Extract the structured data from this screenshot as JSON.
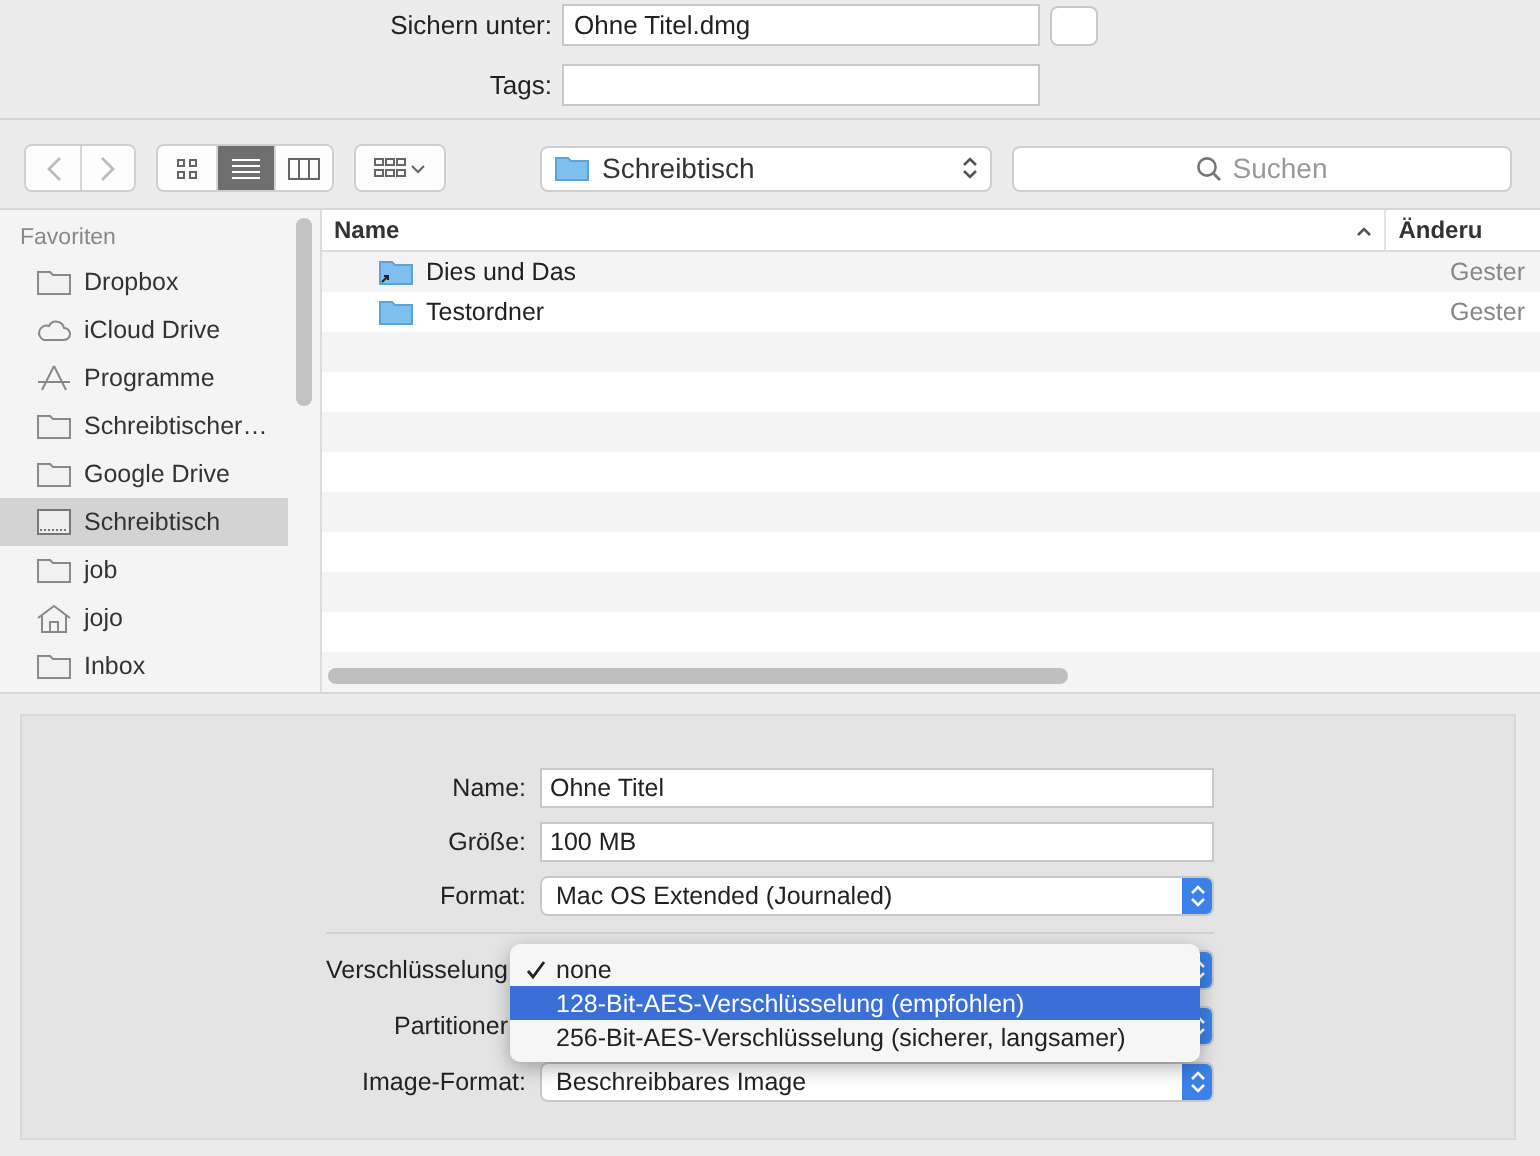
{
  "save_as": {
    "label": "Sichern unter:",
    "value": "Ohne Titel.dmg"
  },
  "tags": {
    "label": "Tags:"
  },
  "toolbar": {
    "view_modes": [
      {
        "kind": "icons",
        "selected": false
      },
      {
        "kind": "list",
        "selected": true
      },
      {
        "kind": "columns",
        "selected": false
      }
    ],
    "location": "Schreibtisch",
    "search": {
      "placeholder": "Suchen"
    }
  },
  "sidebar": {
    "heading": "Favoriten",
    "items": [
      {
        "label": "Dropbox",
        "kind": "folder",
        "selected": false
      },
      {
        "label": "iCloud Drive",
        "kind": "cloud",
        "selected": false
      },
      {
        "label": "Programme",
        "kind": "apps",
        "selected": false
      },
      {
        "label": "Schreibtischer…",
        "kind": "folder",
        "selected": false
      },
      {
        "label": "Google Drive",
        "kind": "folder",
        "selected": false
      },
      {
        "label": "Schreibtisch",
        "kind": "desktop",
        "selected": true
      },
      {
        "label": "job",
        "kind": "folder",
        "selected": false
      },
      {
        "label": "jojo",
        "kind": "home",
        "selected": false
      },
      {
        "label": "Inbox",
        "kind": "folder",
        "selected": false
      }
    ]
  },
  "file_list": {
    "columns": [
      {
        "label": "Name",
        "sorted": true
      },
      {
        "label": "Änderu",
        "sorted": false
      }
    ],
    "rows": [
      {
        "name": "Dies und Das",
        "alias": true,
        "modified": "Gester"
      },
      {
        "name": "Testordner",
        "alias": false,
        "modified": "Gester"
      }
    ]
  },
  "disk_image": {
    "fields": [
      {
        "label": "Name:",
        "kind": "text",
        "value": "Ohne Titel"
      },
      {
        "label": "Größe:",
        "kind": "text",
        "value": "100 MB"
      },
      {
        "label": "Format:",
        "kind": "popup",
        "value": "Mac OS Extended (Journaled)"
      }
    ],
    "options": [
      {
        "label": "Verschlüsselung",
        "kind": "popup"
      },
      {
        "label": "Partitioner",
        "kind": "popup"
      },
      {
        "label": "Image-Format:",
        "kind": "popup",
        "value": "Beschreibbares Image"
      }
    ],
    "menu": [
      {
        "label": "none",
        "checked": true,
        "selected": false
      },
      {
        "label": "128-Bit-AES-Verschlüsselung (empfohlen)",
        "checked": false,
        "selected": true
      },
      {
        "label": "256-Bit-AES-Verschlüsselung (sicherer, langsamer)",
        "checked": false,
        "selected": false
      }
    ]
  }
}
